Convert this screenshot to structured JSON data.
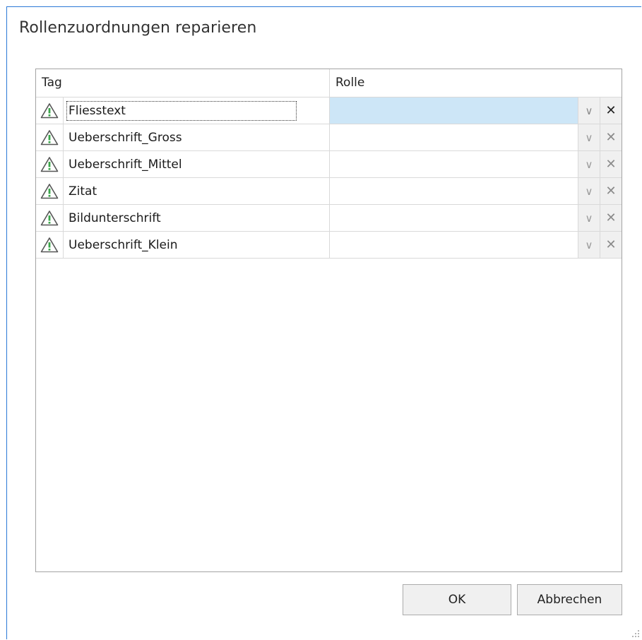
{
  "dialog": {
    "title": "Rollenzuordnungen reparieren"
  },
  "grid": {
    "columns": [
      "Tag",
      "Rolle"
    ],
    "rows": [
      {
        "tag": "Fliesstext",
        "rolle": "",
        "selected": true
      },
      {
        "tag": "Ueberschrift_Gross",
        "rolle": ""
      },
      {
        "tag": "Ueberschrift_Mittel",
        "rolle": ""
      },
      {
        "tag": "Zitat",
        "rolle": ""
      },
      {
        "tag": "Bildunterschrift",
        "rolle": ""
      },
      {
        "tag": "Ueberschrift_Klein",
        "rolle": ""
      }
    ],
    "row_icon": "warning-triangle-icon",
    "dropdown_icon": "chevron-down-icon",
    "clear_icon": "close-icon"
  },
  "buttons": {
    "ok": "OK",
    "cancel": "Abbrechen"
  },
  "colors": {
    "accent": "#2b79d6",
    "selection": "#cde6f7",
    "warning_green": "#3aa64a"
  }
}
